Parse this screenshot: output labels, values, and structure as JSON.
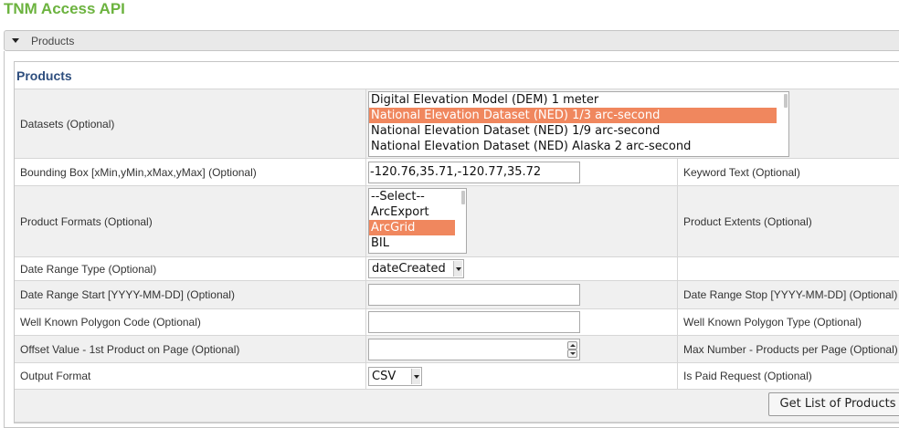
{
  "app": {
    "title": "TNM Access API"
  },
  "accordion": {
    "label": "Products"
  },
  "section": {
    "heading": "Products"
  },
  "datasets": {
    "label": "Datasets (Optional)",
    "options": [
      "Digital Elevation Model (DEM) 1 meter",
      "National Elevation Dataset (NED) 1/3 arc-second",
      "National Elevation Dataset (NED) 1/9 arc-second",
      "National Elevation Dataset (NED) Alaska 2 arc-second"
    ],
    "selected_index": 1
  },
  "bbox": {
    "label": "Bounding Box [xMin,yMin,xMax,yMax] (Optional)",
    "value": "-120.76,35.71,-120.77,35.72"
  },
  "keyword": {
    "label": "Keyword Text (Optional)"
  },
  "formats": {
    "label": "Product Formats (Optional)",
    "options": [
      "--Select--",
      "ArcExport",
      "ArcGrid",
      "BIL"
    ],
    "selected_index": 2
  },
  "extents": {
    "label": "Product Extents (Optional)"
  },
  "date_type": {
    "label": "Date Range Type (Optional)",
    "value": "dateCreated"
  },
  "date_start": {
    "label": "Date Range Start [YYYY-MM-DD] (Optional)",
    "value": ""
  },
  "date_stop": {
    "label": "Date Range Stop [YYYY-MM-DD] (Optional)"
  },
  "polygon_code": {
    "label": "Well Known Polygon Code (Optional)",
    "value": ""
  },
  "polygon_type": {
    "label": "Well Known Polygon Type (Optional)"
  },
  "offset": {
    "label": "Offset Value - 1st Product on Page (Optional)",
    "value": ""
  },
  "max_number": {
    "label": "Max Number - Products per Page (Optional)"
  },
  "output": {
    "label": "Output Format",
    "value": "CSV"
  },
  "paid": {
    "label": "Is Paid Request (Optional)"
  },
  "submit": {
    "label": "Get List of Products"
  },
  "colors": {
    "brand_green": "#6cb33f",
    "heading_blue": "#2e4e7e",
    "selection": "#f0875e"
  },
  "icons": {
    "accordion_toggle": "triangle-down-icon"
  }
}
